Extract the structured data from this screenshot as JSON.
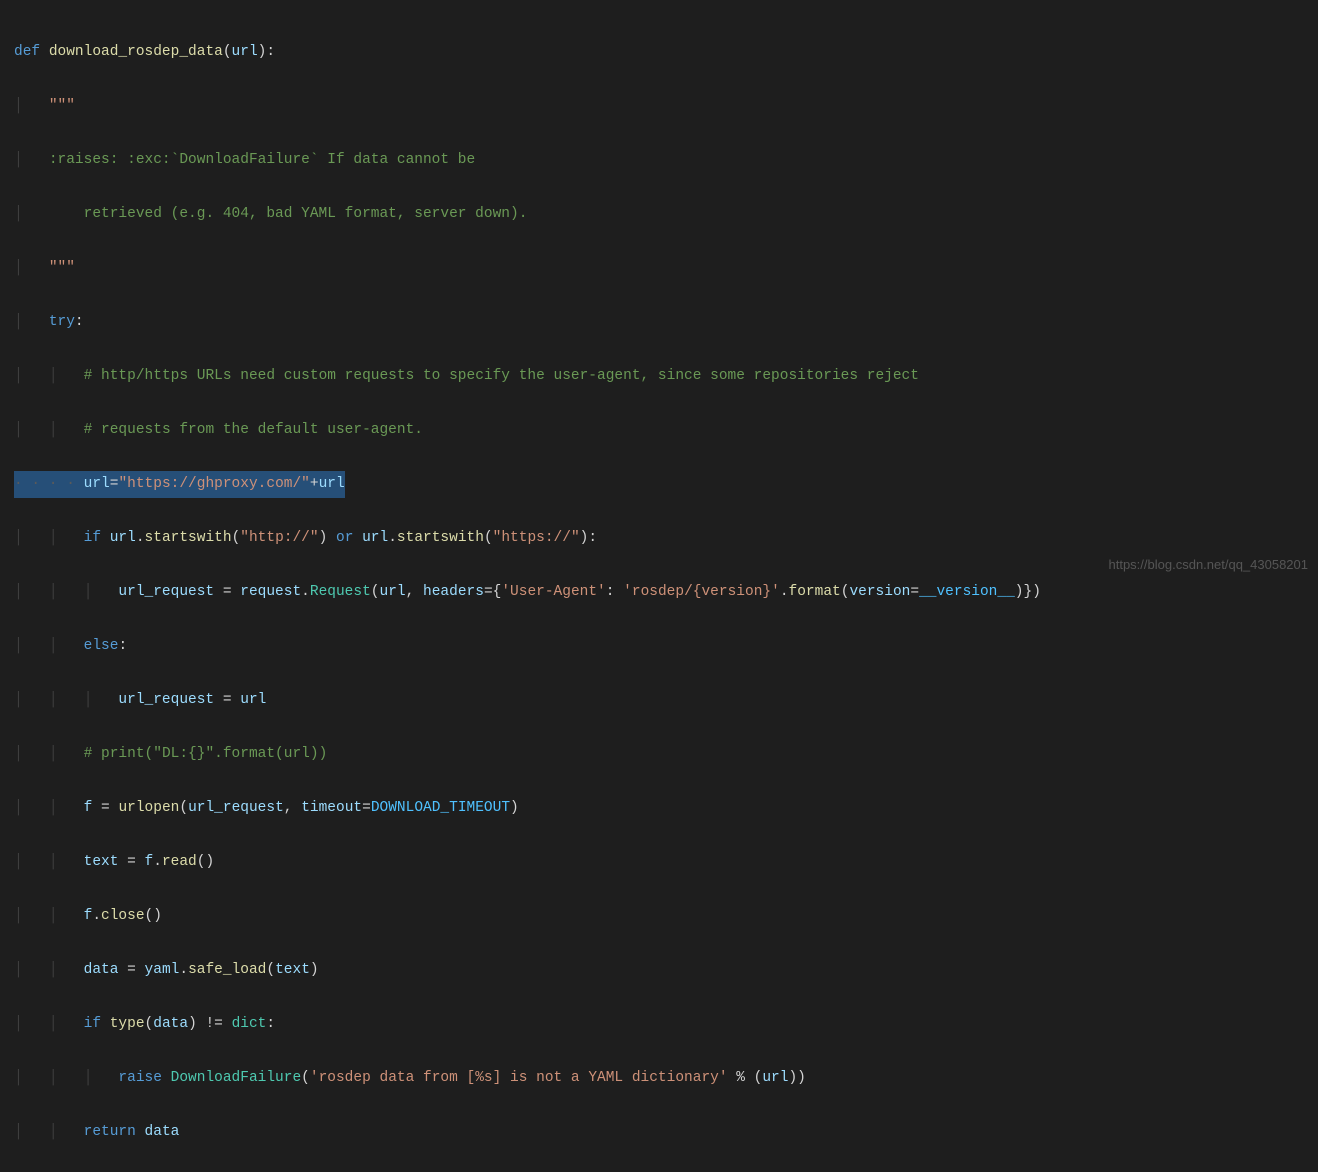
{
  "code": {
    "line1": {
      "def": "def",
      "fn_name": "download_rosdep_data",
      "p_open": "(",
      "param": "url",
      "p_close": ")",
      "colon": ":"
    },
    "line2": {
      "docq": "\"\"\""
    },
    "line3": {
      "doc": ":raises: :exc:`DownloadFailure` If data cannot be"
    },
    "line4": {
      "doc": "    retrieved (e.g. 404, bad YAML format, server down)."
    },
    "line5": {
      "docq": "\"\"\""
    },
    "line6": {
      "try": "try",
      "colon": ":"
    },
    "line7": {
      "comment": "# http/https URLs need custom requests to specify the user-agent, since some repositories reject"
    },
    "line8": {
      "comment": "# requests from the default user-agent."
    },
    "line9": {
      "var": "url",
      "eq": "=",
      "str": "\"https://ghproxy.com/\"",
      "plus": "+",
      "var2": "url"
    },
    "line10": {
      "if": "if",
      "var": "url",
      "dot": ".",
      "fn": "startswith",
      "po": "(",
      "arg": "\"http://\"",
      "pc": ")",
      "or": "or",
      "var2": "url",
      "dot2": ".",
      "fn2": "startswith",
      "po2": "(",
      "arg2": "\"https://\"",
      "pc2": ")",
      "colon": ":"
    },
    "line11": {
      "var": "url_request",
      "eq": " = ",
      "mod": "request",
      "dot": ".",
      "cls": "Request",
      "po": "(",
      "arg1": "url",
      "comma": ", ",
      "kwarg": "headers",
      "eq2": "=",
      "brace_o": "{",
      "key": "'User-Agent'",
      "colon": ": ",
      "val": "'rosdep/{version}'",
      "dot2": ".",
      "fn": "format",
      "po2": "(",
      "kwarg2": "version",
      "eq3": "=",
      "const": "__version__",
      "pc2": ")",
      "brace_c": "}",
      "pc": ")"
    },
    "line12": {
      "else": "else",
      "colon": ":"
    },
    "line13": {
      "var": "url_request",
      "eq": " = ",
      "var2": "url"
    },
    "line14": {
      "comment": "# print(\"DL:{}\".format(url))"
    },
    "line15": {
      "var": "f",
      "eq": " = ",
      "fn": "urlopen",
      "po": "(",
      "arg1": "url_request",
      "comma": ", ",
      "kwarg": "timeout",
      "eq2": "=",
      "const": "DOWNLOAD_TIMEOUT",
      "pc": ")"
    },
    "line16": {
      "var": "text",
      "eq": " = ",
      "obj": "f",
      "dot": ".",
      "fn": "read",
      "po": "(",
      "pc": ")"
    },
    "line17": {
      "obj": "f",
      "dot": ".",
      "fn": "close",
      "po": "(",
      "pc": ")"
    },
    "line18": {
      "var": "data",
      "eq": " = ",
      "mod": "yaml",
      "dot": ".",
      "fn": "safe_load",
      "po": "(",
      "arg": "text",
      "pc": ")"
    },
    "line19": {
      "if": "if",
      "fn": "type",
      "po": "(",
      "arg": "data",
      "pc": ")",
      "neq": " != ",
      "typ": "dict",
      "colon": ":"
    },
    "line20": {
      "raise": "raise",
      "cls": "DownloadFailure",
      "po": "(",
      "str": "'rosdep data from [%s] is not a YAML dictionary'",
      "mod": " % ",
      "po2": "(",
      "arg": "url",
      "pc2": ")",
      "pc": ")"
    },
    "line21": {
      "return": "return",
      "var": "data"
    }
  },
  "watermark": "https://blog.csdn.net/qq_43058201"
}
